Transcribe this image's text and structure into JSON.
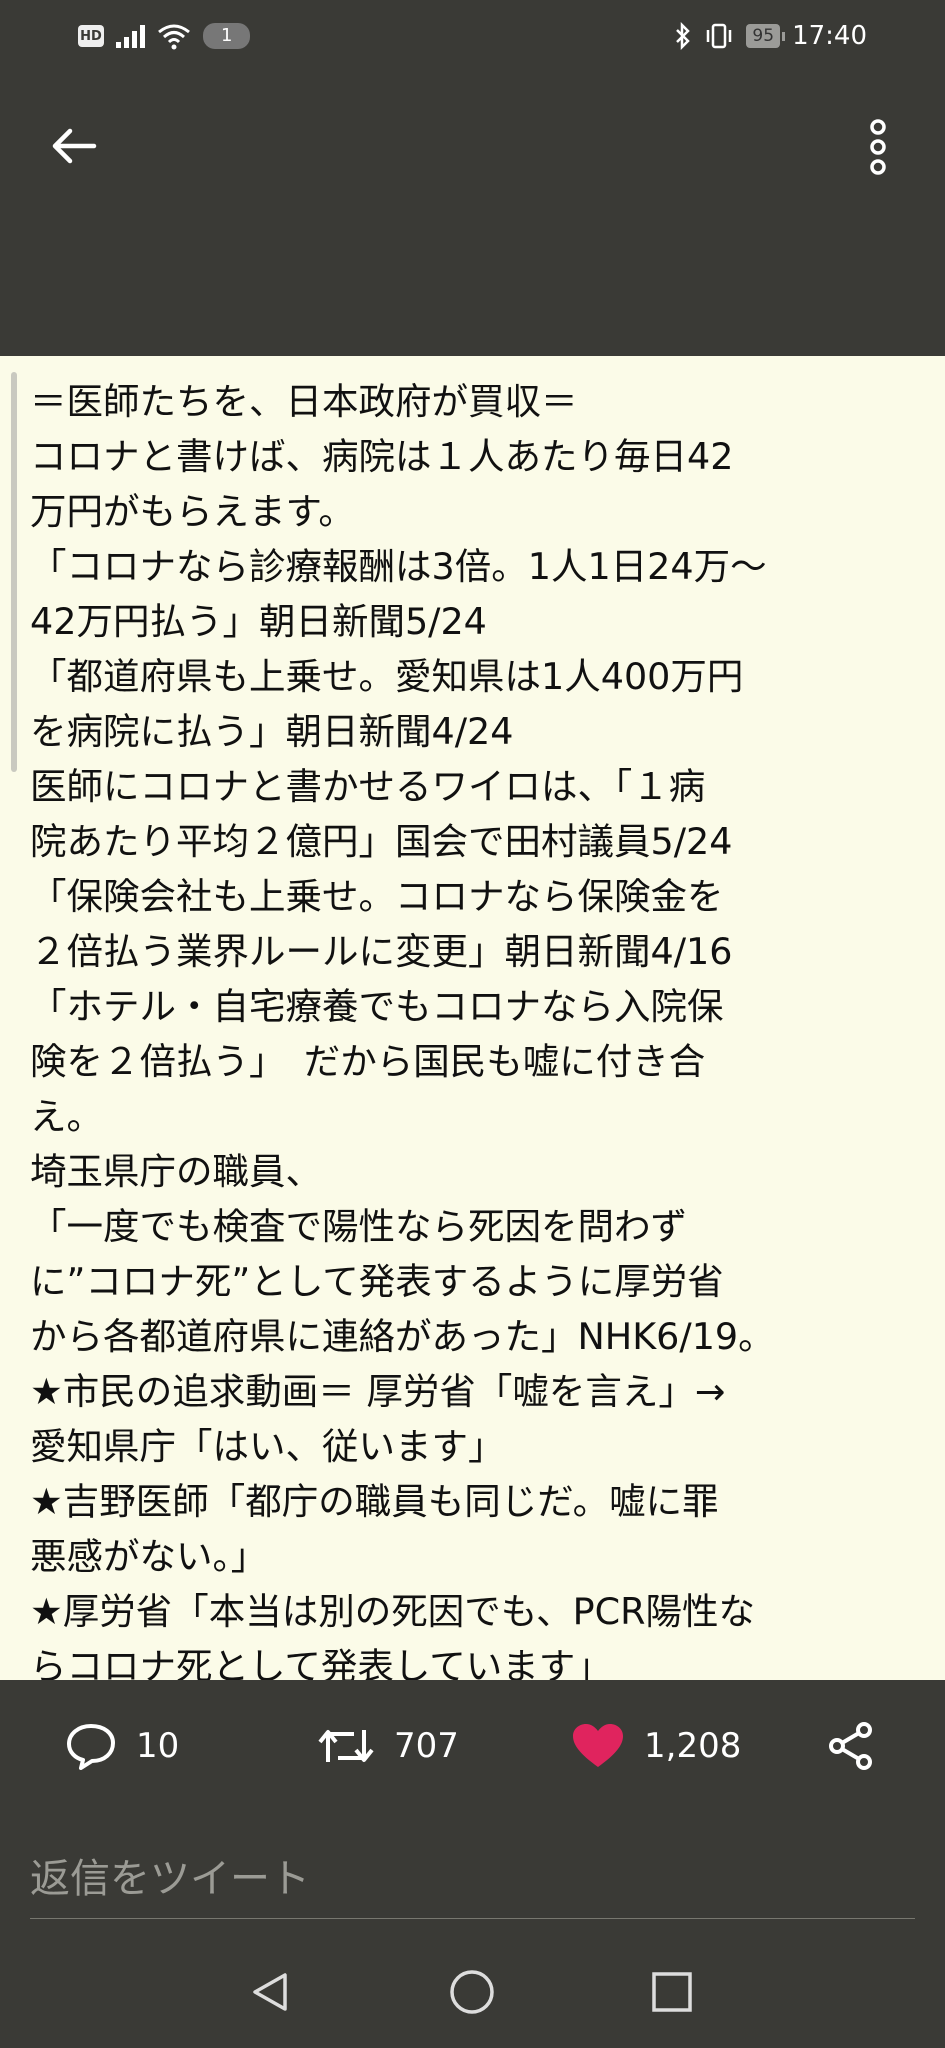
{
  "status_bar": {
    "hd_badge": "HD",
    "sim_badge": "1",
    "battery": "95",
    "time": "17:40"
  },
  "header": {
    "back_icon": "arrow-left-icon",
    "more_icon": "more-vertical-icon"
  },
  "tweet": {
    "lines": [
      "＝医師たちを、日本政府が買収＝",
      "コロナと書けば、病院は１人あたり毎日42",
      "万円がもらえます。",
      "「コロナなら診療報酬は3倍。1人1日24万〜",
      "42万円払う」朝日新聞5/24",
      "「都道府県も上乗せ。愛知県は1人400万円",
      "を病院に払う」朝日新聞4/24",
      "医師にコロナと書かせるワイロは、「１病",
      "院あたり平均２億円」国会で田村議員5/24",
      "「保険会社も上乗せ。コロナなら保険金を",
      "２倍払う業界ルールに変更」朝日新聞4/16",
      "「ホテル・自宅療養でもコロナなら入院保",
      "険を２倍払う」　だから国民も嘘に付き合",
      "え。",
      "埼玉県庁の職員、",
      "「一度でも検査で陽性なら死因を問わず",
      "に”コロナ死”として発表するように厚労省",
      "から各都道府県に連絡があった」NHK6/19。",
      "★市民の追求動画＝ 厚労省「嘘を言え」→",
      "愛知県庁「はい、従います」",
      "★吉野医師「都庁の職員も同じだ。嘘に罪",
      "悪感がない。」",
      "★厚労省「本当は別の死因でも、PCR陽性な",
      "らコロナ死として発表しています」"
    ]
  },
  "actions": {
    "replies": "10",
    "retweets": "707",
    "likes": "1,208",
    "like_color": "#e0245e",
    "icons": [
      "comment-icon",
      "retweet-icon",
      "heart-icon",
      "share-icon"
    ]
  },
  "reply_box": {
    "placeholder": "返信をツイート"
  },
  "nav": {
    "icons": [
      "nav-back-icon",
      "nav-home-icon",
      "nav-recents-icon"
    ]
  }
}
